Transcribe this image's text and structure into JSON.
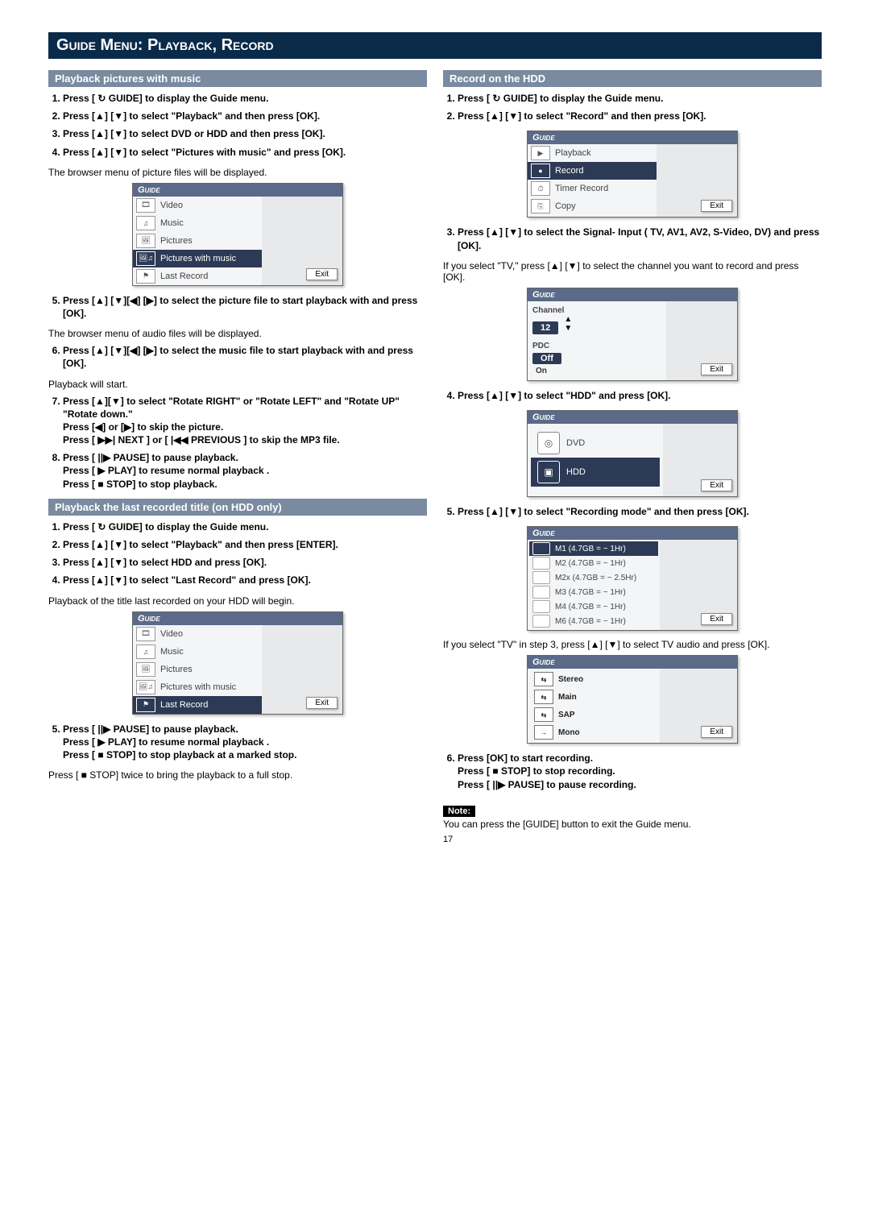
{
  "title": "Guide Menu: Playback, Record",
  "left": {
    "section1": {
      "header": "Playback pictures with music",
      "steps": {
        "s1": "Press [ ↻ GUIDE] to display the Guide menu.",
        "s2": "Press [▲]  [▼] to select \"Playback\" and then press [OK].",
        "s3": "Press [▲]  [▼] to select  DVD or HDD and then press [OK].",
        "s4": "Press [▲]  [▼] to select \"Pictures with music\" and press [OK].",
        "note4": "The browser menu of picture files will be displayed.",
        "s5": "Press [▲] [▼][◀] [▶] to select the picture file to start playback with and press [OK].",
        "note5": "The browser menu of audio files will be displayed.",
        "s6": "Press [▲] [▼][◀] [▶] to select the music file to start playback with and press [OK].",
        "note6": "Playback will start.",
        "s7": "Press [▲][▼] to select \"Rotate RIGHT\" or \"Rotate LEFT\" and \"Rotate UP\" \"Rotate down.\"\nPress [◀] or [▶] to skip the picture.\nPress [ ▶▶| NEXT ] or [ |◀◀ PREVIOUS ] to skip the MP3 file.",
        "s8": "Press [ ||▶ PAUSE] to pause playback.\nPress [ ▶ PLAY] to resume normal playback .\nPress [ ■ STOP] to stop playback."
      },
      "guide": {
        "title": "Guide",
        "items": [
          "Video",
          "Music",
          "Pictures",
          "Pictures with music",
          "Last Record"
        ],
        "selected": 3,
        "exit": "Exit"
      }
    },
    "section2": {
      "header": "Playback the last recorded title (on HDD only)",
      "steps": {
        "s1": "Press [ ↻ GUIDE] to display the Guide menu.",
        "s2": "Press [▲] [▼] to select \"Playback\" and then press [ENTER].",
        "s3": "Press [▲] [▼] to select HDD and press [OK].",
        "s4": "Press [▲] [▼] to select \"Last Record\" and press [OK].",
        "note4": "Playback of the title last recorded on your HDD will begin.",
        "s5": "Press [ ||▶ PAUSE] to pause playback.\nPress [ ▶ PLAY] to resume normal playback .\nPress [ ■ STOP] to stop playback at a marked stop.",
        "note5": "Press [ ■ STOP] twice to bring the playback to a full stop."
      },
      "guide": {
        "title": "Guide",
        "items": [
          "Video",
          "Music",
          "Pictures",
          "Pictures with music",
          "Last Record"
        ],
        "selected": 4,
        "exit": "Exit"
      }
    }
  },
  "right": {
    "section": {
      "header": "Record on the HDD",
      "steps": {
        "s1": "Press [ ↻ GUIDE] to display the Guide menu.",
        "s2": "Press [▲]  [▼] to select \"Record\" and then press [OK].",
        "s3": "Press [▲]  [▼] to select the Signal- Input ( TV, AV1, AV2, S-Video, DV) and press [OK].",
        "note3": "If you select \"TV,\" press [▲] [▼] to select the channel you want to record and press [OK].",
        "s4": "Press [▲]  [▼] to select \"HDD\" and press [OK].",
        "s5": "Press [▲]  [▼] to select \"Recording mode\" and then press [OK].",
        "note5": "If you select \"TV\" in step 3, press [▲] [▼] to select TV audio and press [OK].",
        "s6": "Press [OK] to start recording.\nPress [ ■ STOP] to stop recording.\nPress [ ||▶ PAUSE] to pause recording."
      },
      "guide_main": {
        "title": "Guide",
        "items": [
          "Playback",
          "Record",
          "Timer Record",
          "Copy"
        ],
        "selected": 1,
        "exit": "Exit"
      },
      "guide_channel": {
        "title": "Guide",
        "channel_label": "Channel",
        "channel_value": "12",
        "pdc_label": "PDC",
        "pdc_off": "Off",
        "pdc_on": "On",
        "exit": "Exit"
      },
      "guide_target": {
        "title": "Guide",
        "items": [
          "DVD",
          "HDD"
        ],
        "selected": 1,
        "exit": "Exit"
      },
      "guide_mode": {
        "title": "Guide",
        "items": [
          "M1 (4.7GB = ~ 1Hr)",
          "M2 (4.7GB = ~ 1Hr)",
          "M2x (4.7GB = ~ 2.5Hr)",
          "M3 (4.7GB = ~ 1Hr)",
          "M4 (4.7GB = ~ 1Hr)",
          "M6 (4.7GB = ~ 1Hr)"
        ],
        "selected": 0,
        "exit": "Exit"
      },
      "guide_audio": {
        "title": "Guide",
        "items": [
          "Stereo",
          "Main",
          "SAP",
          "Mono"
        ],
        "exit": "Exit"
      },
      "note_label": "Note:",
      "note_text": "You can press the [GUIDE] button to exit the Guide menu."
    }
  },
  "pagenum": "17"
}
